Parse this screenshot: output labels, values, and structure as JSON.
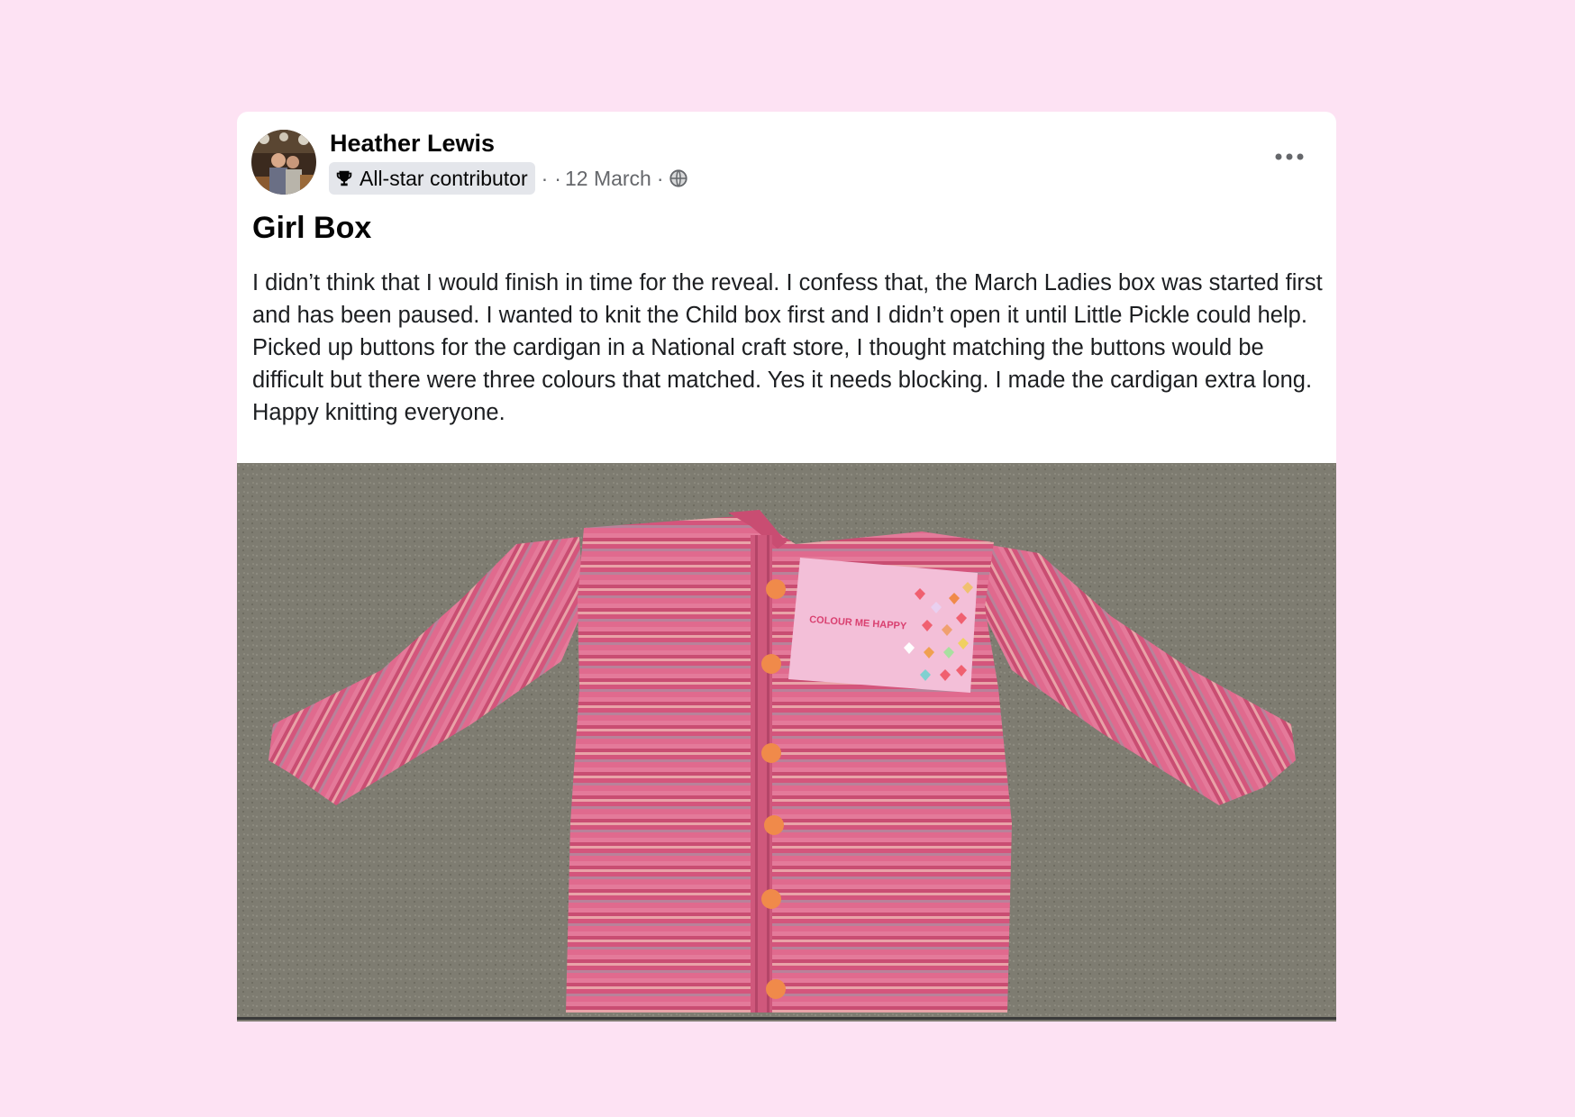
{
  "post": {
    "author": "Heather Lewis",
    "badge": "All-star contributor",
    "separator": "·",
    "date_prefix": "·",
    "date": "12 March",
    "date_suffix": "·",
    "audience_icon": "globe-icon",
    "more_icon": "more-options-icon",
    "badge_icon": "trophy-icon",
    "title": "Girl Box",
    "body": "I didn’t think that I would finish in time for the reveal. I confess that, the March Ladies box was started first and has been paused. I wanted to knit the Child box first and I didn’t open it until Little Pickle could help. Picked up buttons for the cardigan in a National craft store, I thought matching the buttons would be difficult but there were three colours that matched. Yes it needs blocking. I made the cardigan extra long. Happy knitting everyone.",
    "photo": {
      "card_text": "COLOUR ME HAPPY"
    }
  },
  "colors": {
    "page_background": "#fde2f3",
    "card_background": "#ffffff",
    "carpet": "#7d7b70",
    "cardigan_pink": "#d9607f",
    "button_orange": "#f08a4a"
  }
}
